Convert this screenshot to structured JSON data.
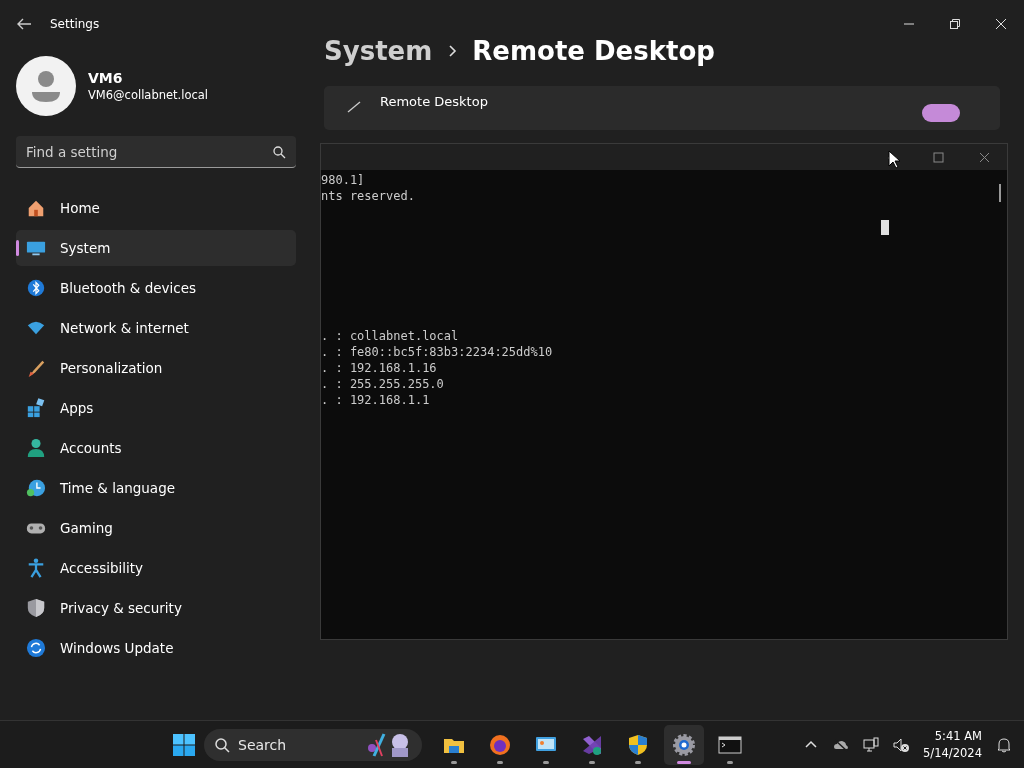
{
  "settings": {
    "title": "Settings",
    "user": {
      "name": "VM6",
      "email": "VM6@collabnet.local"
    },
    "search": {
      "placeholder": "Find a setting"
    },
    "nav": [
      {
        "label": "Home",
        "selected": false
      },
      {
        "label": "System",
        "selected": true
      },
      {
        "label": "Bluetooth & devices",
        "selected": false
      },
      {
        "label": "Network & internet",
        "selected": false
      },
      {
        "label": "Personalization",
        "selected": false
      },
      {
        "label": "Apps",
        "selected": false
      },
      {
        "label": "Accounts",
        "selected": false
      },
      {
        "label": "Time & language",
        "selected": false
      },
      {
        "label": "Gaming",
        "selected": false
      },
      {
        "label": "Accessibility",
        "selected": false
      },
      {
        "label": "Privacy & security",
        "selected": false
      },
      {
        "label": "Windows Update",
        "selected": false
      }
    ],
    "breadcrumb": [
      "System",
      "Remote Desktop"
    ],
    "card": {
      "title": "Remote Desktop",
      "on": true
    }
  },
  "terminal": {
    "header_lines": [
      "980.1]",
      "nts reserved."
    ],
    "lines": [
      ". : collabnet.local",
      ". : fe80::bc5f:83b3:2234:25dd%10",
      ". : 192.168.1.16",
      ". : 255.255.255.0",
      ". : 192.168.1.1"
    ]
  },
  "taskbar": {
    "search": {
      "placeholder": "Search"
    },
    "apps": [
      {
        "selected": false
      },
      {
        "selected": false
      },
      {
        "selected": false
      },
      {
        "selected": false
      },
      {
        "selected": false
      },
      {
        "selected": true
      },
      {
        "selected": false
      }
    ],
    "time": "5:41 AM",
    "date": "5/14/2024"
  }
}
